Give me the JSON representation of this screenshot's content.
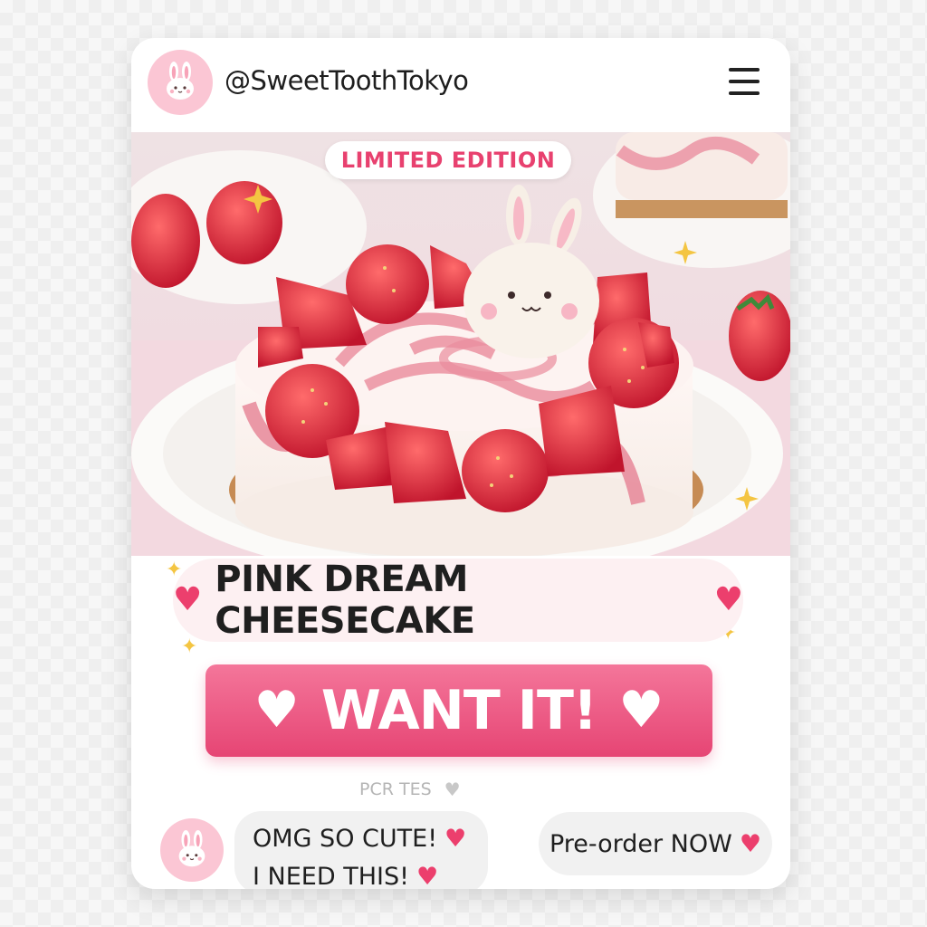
{
  "profile": {
    "handle": "@SweetToothTokyo",
    "avatar_icon": "bunny-icon"
  },
  "menu": {
    "icon": "hamburger-menu-icon"
  },
  "hero": {
    "badge": "LIMITED EDITION",
    "image_alt": "strawberry swirl cheesecake with bunny cookie"
  },
  "product": {
    "title": "PINK DREAM CHEESECAKE",
    "heart": "♥"
  },
  "cta": {
    "label": "WANT IT!",
    "heart": "♥"
  },
  "footer_faint": {
    "text": "PCR TES",
    "heart": "♥"
  },
  "comments": [
    {
      "line1": "OMG SO CUTE!",
      "line2": "I NEED THIS!",
      "heart": "♥"
    }
  ],
  "preorder": {
    "label": "Pre-order NOW",
    "heart": "♥"
  },
  "colors": {
    "accent": "#ec3f6d",
    "button_top": "#f4769a",
    "button_bottom": "#e64574",
    "avatar_bg": "#fbc6d4"
  }
}
